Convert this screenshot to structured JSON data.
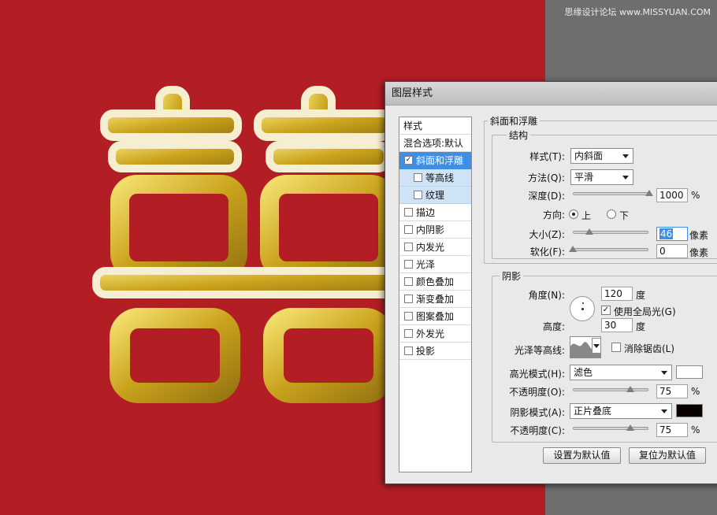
{
  "watermark": "思缘设计论坛 www.MISSYUAN.COM",
  "dialog": {
    "title": "图层样式",
    "style_list": {
      "header": "样式",
      "blend": "混合选项:默认",
      "items": [
        {
          "label": "斜面和浮雕",
          "checked": true,
          "selected": true
        },
        {
          "label": "等高线",
          "checked": false,
          "sub": true
        },
        {
          "label": "纹理",
          "checked": false,
          "sub": true
        },
        {
          "label": "描边",
          "checked": false
        },
        {
          "label": "内阴影",
          "checked": false
        },
        {
          "label": "内发光",
          "checked": false
        },
        {
          "label": "光泽",
          "checked": false
        },
        {
          "label": "颜色叠加",
          "checked": false
        },
        {
          "label": "渐变叠加",
          "checked": false
        },
        {
          "label": "图案叠加",
          "checked": false
        },
        {
          "label": "外发光",
          "checked": false
        },
        {
          "label": "投影",
          "checked": false
        }
      ]
    },
    "bevel": {
      "title": "斜面和浮雕",
      "structure_title": "结构",
      "style_label": "样式(T):",
      "style_value": "内斜面",
      "method_label": "方法(Q):",
      "method_value": "平滑",
      "depth_label": "深度(D):",
      "depth_value": "1000",
      "depth_unit": "%",
      "direction_label": "方向:",
      "direction_up": "上",
      "direction_down": "下",
      "size_label": "大小(Z):",
      "size_value": "46",
      "size_unit": "像素",
      "soften_label": "软化(F):",
      "soften_value": "0",
      "soften_unit": "像素"
    },
    "shading": {
      "title": "阴影",
      "angle_label": "角度(N):",
      "angle_value": "120",
      "angle_unit": "度",
      "global_light_label": "使用全局光(G)",
      "global_light_checked": true,
      "altitude_label": "高度:",
      "altitude_value": "30",
      "altitude_unit": "度",
      "gloss_contour_label": "光泽等高线:",
      "anti_alias_label": "消除锯齿(L)",
      "highlight_mode_label": "高光模式(H):",
      "highlight_mode_value": "滤色",
      "highlight_color": "#ffffff",
      "highlight_opacity_label": "不透明度(O):",
      "highlight_opacity_value": "75",
      "highlight_opacity_unit": "%",
      "shadow_mode_label": "阴影模式(A):",
      "shadow_mode_value": "正片叠底",
      "shadow_color": "#0a0000",
      "shadow_opacity_label": "不透明度(C):",
      "shadow_opacity_value": "75",
      "shadow_opacity_unit": "%"
    },
    "make_default": "设置为默认值",
    "reset_default": "复位为默认值"
  },
  "colors": {
    "canvas_red": "#b21e24",
    "gold": "#d7b62a",
    "selection_blue": "#3f8ee6"
  }
}
